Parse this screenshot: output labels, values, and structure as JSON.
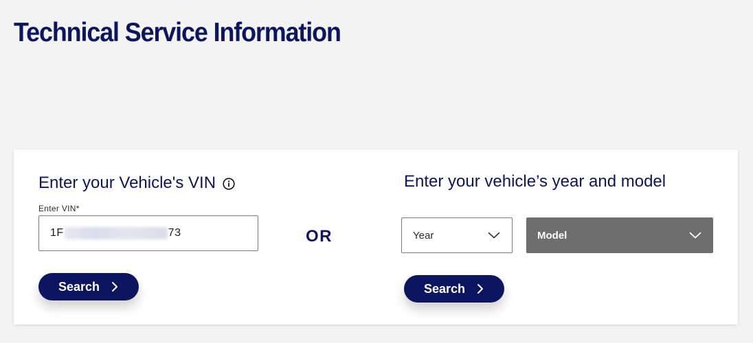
{
  "page": {
    "title": "Technical Service Information"
  },
  "vin_section": {
    "heading": "Enter your Vehicle's VIN",
    "field_label": "Enter VIN*",
    "value_prefix": "1F",
    "value_suffix": "73",
    "search_label": "Search"
  },
  "divider": {
    "or_label": "OR"
  },
  "year_model_section": {
    "heading": "Enter your vehicle’s year and model",
    "year_selected": "Year",
    "model_selected": "Model",
    "search_label": "Search"
  },
  "colors": {
    "brand_navy": "#0b1560",
    "model_select_bg": "#6e6e6e",
    "page_bg": "#f3f3f3"
  },
  "icons": [
    "info-icon",
    "chevron-right-icon",
    "chevron-down-icon"
  ]
}
